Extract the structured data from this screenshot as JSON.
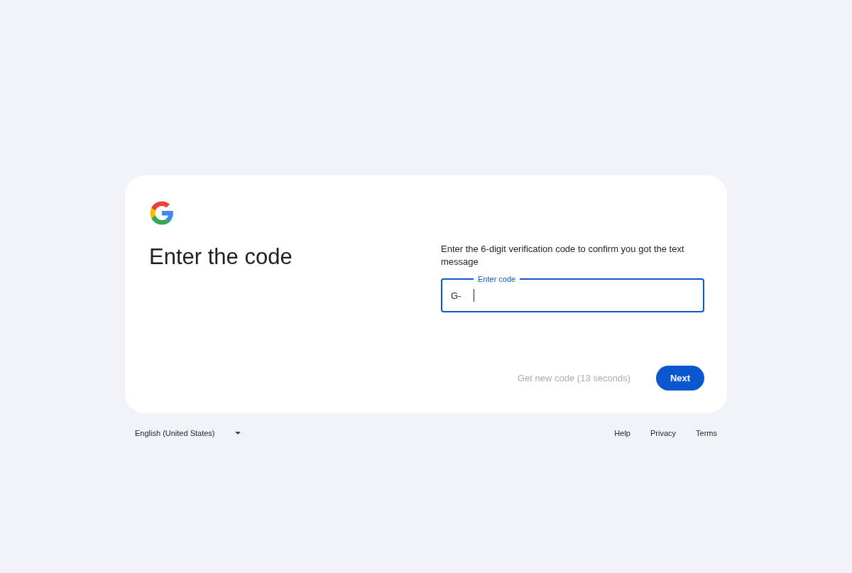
{
  "heading": "Enter the code",
  "description": "Enter the 6-digit verification code to confirm you got the text message",
  "code_field": {
    "label": "Enter code",
    "prefix": "G-",
    "focused": true
  },
  "actions": {
    "resend": {
      "label": "Get new code (13 seconds)",
      "disabled": true
    },
    "next": {
      "label": "Next"
    }
  },
  "footer": {
    "language": "English (United States)",
    "links": [
      "Help",
      "Privacy",
      "Terms"
    ]
  }
}
